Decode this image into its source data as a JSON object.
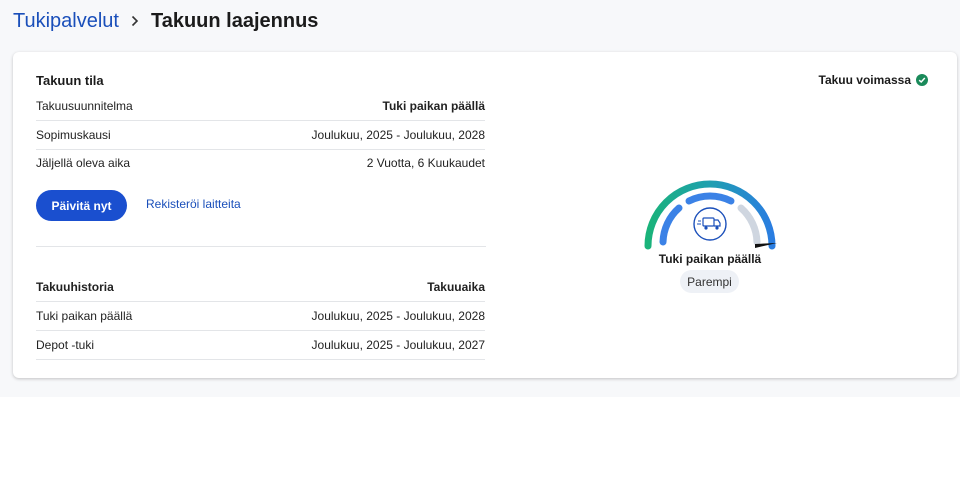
{
  "breadcrumb": {
    "parent": "Tukipalvelut",
    "current": "Takuun laajennus"
  },
  "status": {
    "label": "Takuu voimassa",
    "icon": "check-circle-icon",
    "color": "#1a8a5a"
  },
  "warranty_status": {
    "title": "Takuun tila",
    "rows": [
      {
        "label": "Takuusuunnitelma",
        "value": "Tuki paikan päällä"
      },
      {
        "label": "Sopimuskausi",
        "value": "Joulukuu, 2025 - Joulukuu, 2028"
      },
      {
        "label": "Jäljellä oleva aika",
        "value": "2 Vuotta, 6 Kuukaudet"
      }
    ],
    "update_button": "Päivitä nyt",
    "register_link": "Rekisteröi laitteita"
  },
  "history": {
    "headers": [
      "Takuuhistoria",
      "Takuuaika"
    ],
    "rows": [
      {
        "label": "Tuki paikan päällä",
        "value": "Joulukuu, 2025 - Joulukuu, 2028"
      },
      {
        "label": "Depot -tuki",
        "value": "Joulukuu, 2025 - Joulukuu, 2027"
      }
    ]
  },
  "gauge": {
    "label": "Tuki paikan päällä",
    "level": "Parempi",
    "icon": "service-van-icon",
    "colors": {
      "outer_start": "#1ab37a",
      "outer_end": "#2a7de1",
      "inner": "#3b82e6",
      "inactive": "#cfd6e0"
    }
  },
  "colors": {
    "accent": "#1a4fcf",
    "link": "#1a4fba"
  }
}
